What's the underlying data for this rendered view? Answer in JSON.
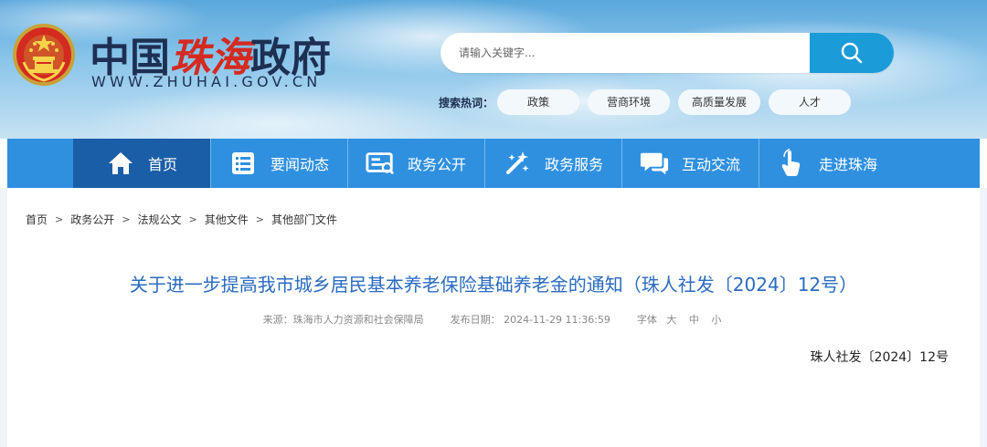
{
  "site": {
    "logo_prefix": "中国",
    "logo_highlight": "珠海",
    "logo_suffix": "政府",
    "domain": "WWW.ZHUHAI.GOV.CN"
  },
  "search": {
    "placeholder": "请输入关键字...",
    "hot_label": "搜索热词：",
    "hot_words": [
      "政策",
      "营商环境",
      "高质量发展",
      "人才"
    ]
  },
  "nav": {
    "items": [
      {
        "label": "首页",
        "icon": "home-icon"
      },
      {
        "label": "要闻动态",
        "icon": "news-list-icon"
      },
      {
        "label": "政务公开",
        "icon": "document-icon"
      },
      {
        "label": "政务服务",
        "icon": "service-sparkle-icon"
      },
      {
        "label": "互动交流",
        "icon": "chat-icon"
      },
      {
        "label": "走进珠海",
        "icon": "pointer-hand-icon"
      }
    ],
    "active_index": 0
  },
  "breadcrumb": {
    "items": [
      "首页",
      "政务公开",
      "法规公文",
      "其他文件",
      "其他部门文件"
    ],
    "separator": ">"
  },
  "article": {
    "title": "关于进一步提高我市城乡居民基本养老保险基础养老金的通知（珠人社发〔2024〕12号）",
    "source": "来源：珠海市人力资源和社会保障局",
    "publish_date": "发布日期： 2024-11-29 11:36:59",
    "font_label": "字体",
    "font_sizes": [
      "大",
      "中",
      "小"
    ],
    "doc_number": "珠人社发〔2024〕12号"
  },
  "colors": {
    "nav_bg": "#2f90e0",
    "nav_active": "#1b5ea8",
    "title_blue": "#2a6bc0",
    "search_btn": "#1b9bd8",
    "logo_red": "#d42a20",
    "logo_navy": "#1d2f52"
  }
}
